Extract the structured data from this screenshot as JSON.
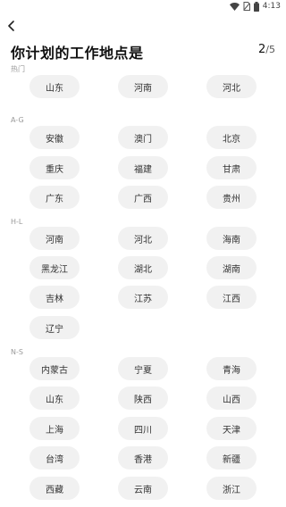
{
  "status_bar": {
    "time": "4:13",
    "icons": [
      "wifi-icon",
      "no-sim-icon",
      "battery-icon"
    ]
  },
  "header": {
    "back_icon": "chevron-left-icon",
    "title": "你计划的工作地点是",
    "progress_current": "2",
    "progress_total": "/5"
  },
  "sections": [
    {
      "label": "热门",
      "rows": [
        [
          "山东",
          "河南",
          "河北"
        ]
      ]
    },
    {
      "label": "A-G",
      "rows": [
        [
          "安徽",
          "澳门",
          "北京"
        ],
        [
          "重庆",
          "福建",
          "甘肃"
        ],
        [
          "广东",
          "广西",
          "贵州"
        ]
      ]
    },
    {
      "label": "H-L",
      "rows": [
        [
          "河南",
          "河北",
          "海南"
        ],
        [
          "黑龙江",
          "湖北",
          "湖南"
        ],
        [
          "吉林",
          "江苏",
          "江西"
        ],
        [
          "辽宁"
        ]
      ]
    },
    {
      "label": "N-S",
      "rows": [
        [
          "内蒙古",
          "宁夏",
          "青海"
        ],
        [
          "山东",
          "陕西",
          "山西"
        ],
        [
          "上海",
          "四川",
          "天津"
        ],
        [
          "台湾",
          "香港",
          "新疆"
        ],
        [
          "西藏",
          "云南",
          "浙江"
        ]
      ]
    }
  ],
  "colors": {
    "chip_bg": "#f1f1f1",
    "chip_text": "#333333",
    "section_label": "#9a9a9a",
    "title": "#111111"
  }
}
